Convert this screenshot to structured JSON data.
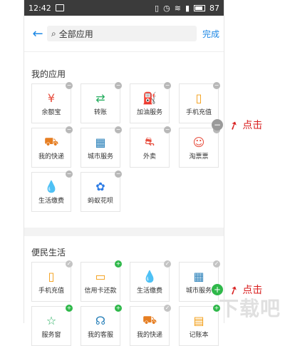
{
  "status_bar": {
    "time": "12:42",
    "battery": "87"
  },
  "search": {
    "back_icon": "back-arrow-icon",
    "text": "全部应用",
    "done_label": "完成"
  },
  "sections": {
    "my_apps": {
      "title": "我的应用",
      "items": [
        {
          "label": "余额宝",
          "icon": "yuebao-icon",
          "color": "#e74c3c",
          "badge": "−"
        },
        {
          "label": "转账",
          "icon": "transfer-icon",
          "color": "#27ae60",
          "badge": "−"
        },
        {
          "label": "加油服务",
          "icon": "fuel-icon",
          "color": "#2ecc71",
          "badge": "−"
        },
        {
          "label": "手机充值",
          "icon": "phone-topup-icon",
          "color": "#f39c12",
          "badge": "−"
        },
        {
          "label": "我的快递",
          "icon": "truck-icon",
          "color": "#e67e22",
          "badge": "−"
        },
        {
          "label": "城市服务",
          "icon": "building-icon",
          "color": "#2980b9",
          "badge": "−"
        },
        {
          "label": "外卖",
          "icon": "scooter-icon",
          "color": "#e74c3c",
          "badge": "−"
        },
        {
          "label": "淘票票",
          "icon": "ticket-face-icon",
          "color": "#e74c3c",
          "badge": "−"
        },
        {
          "label": "生活缴费",
          "icon": "drop-icon",
          "color": "#3498db",
          "badge": "−"
        },
        {
          "label": "蚂蚁花呗",
          "icon": "huabei-icon",
          "color": "#2c7be5",
          "badge": "−"
        }
      ]
    },
    "convenience": {
      "title": "便民生活",
      "items": [
        {
          "label": "手机充值",
          "icon": "phone-topup-icon",
          "color": "#f39c12",
          "badge": "✓"
        },
        {
          "label": "信用卡还款",
          "icon": "credit-card-icon",
          "color": "#f39c12",
          "badge": "+"
        },
        {
          "label": "生活缴费",
          "icon": "drop-icon",
          "color": "#3498db",
          "badge": "✓"
        },
        {
          "label": "城市服务",
          "icon": "building-icon",
          "color": "#2980b9",
          "badge": "✓"
        },
        {
          "label": "服务窗",
          "icon": "service-window-icon",
          "color": "#27ae60",
          "badge": "+"
        },
        {
          "label": "我的客服",
          "icon": "headset-icon",
          "color": "#2980b9",
          "badge": "+"
        },
        {
          "label": "我的快递",
          "icon": "truck-icon",
          "color": "#e67e22",
          "badge": "✓"
        },
        {
          "label": "记账本",
          "icon": "notebook-icon",
          "color": "#f39c12",
          "badge": "+"
        }
      ]
    }
  },
  "callouts": [
    {
      "symbol": "−",
      "text": "点击",
      "color": "#d81e1e"
    },
    {
      "symbol": "+",
      "text": "点击",
      "color": "#d81e1e"
    }
  ],
  "watermark": "下载吧"
}
